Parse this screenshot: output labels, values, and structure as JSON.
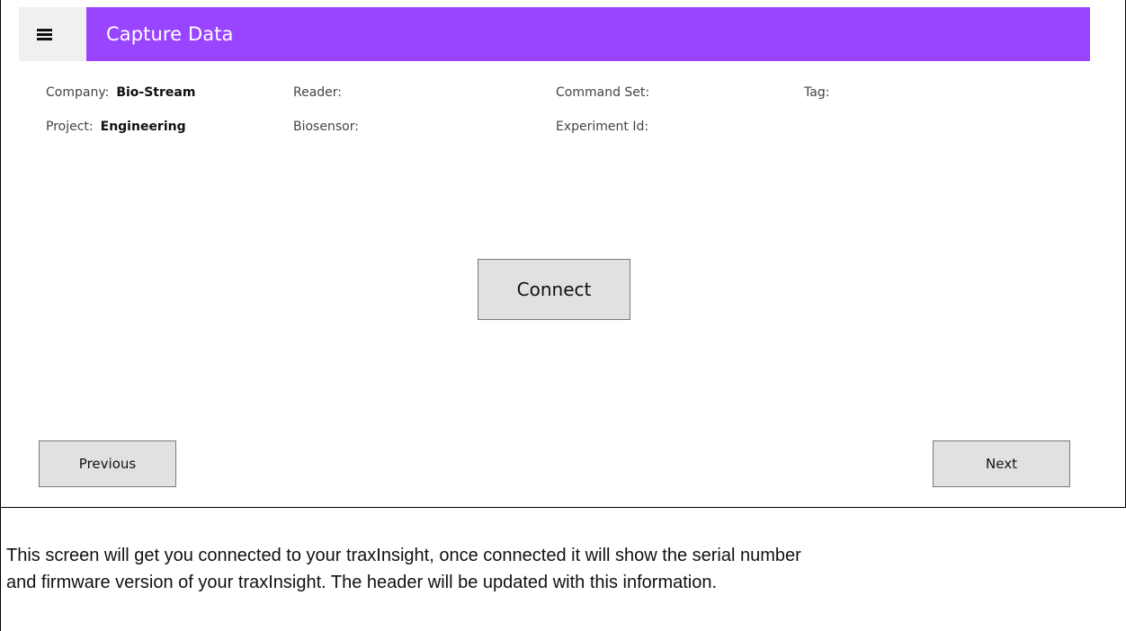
{
  "app": {
    "title": "Capture Data",
    "accent_color": "#9945ff",
    "menu_icon": "hamburger-menu-icon"
  },
  "header_info": {
    "company_label": "Company:",
    "company_value": "Bio-Stream",
    "project_label": "Project:",
    "project_value": "Engineering",
    "reader_label": "Reader:",
    "biosensor_label": "Biosensor:",
    "command_set_label": "Command Set:",
    "experiment_id_label": "Experiment Id:",
    "tag_label": "Tag:"
  },
  "actions": {
    "connect_label": "Connect",
    "previous_label": "Previous",
    "next_label": "Next"
  },
  "description": {
    "line1": "This screen will get you connected to your traxInsight, once connected it will show the serial number",
    "line2": "and firmware version of your traxInsight.  The header will be updated with this information."
  }
}
